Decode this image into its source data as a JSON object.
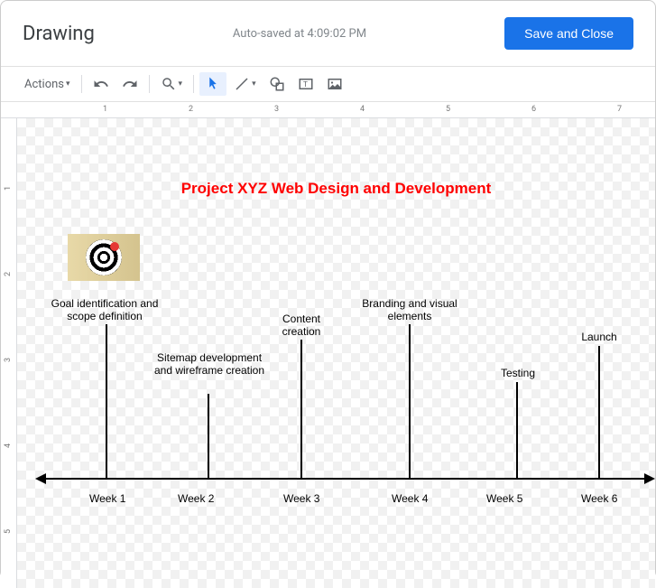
{
  "header": {
    "title": "Drawing",
    "autosave": "Auto-saved at 4:09:02 PM",
    "save_button": "Save and Close"
  },
  "toolbar": {
    "actions": "Actions"
  },
  "drawing": {
    "title": "Project XYZ Web Design and Development",
    "milestones": [
      {
        "label": "Goal identification and scope definition",
        "week": "Week 1"
      },
      {
        "label": "Sitemap development and wireframe creation",
        "week": "Week 2"
      },
      {
        "label": "Content creation",
        "week": "Week 3"
      },
      {
        "label": "Branding and visual elements",
        "week": "Week 4"
      },
      {
        "label": "Testing",
        "week": "Week 5"
      },
      {
        "label": "Launch",
        "week": "Week 6"
      }
    ]
  },
  "ruler": {
    "h": [
      "1",
      "2",
      "3",
      "4",
      "5",
      "6",
      "7"
    ],
    "v": [
      "1",
      "2",
      "3",
      "4",
      "5"
    ]
  }
}
